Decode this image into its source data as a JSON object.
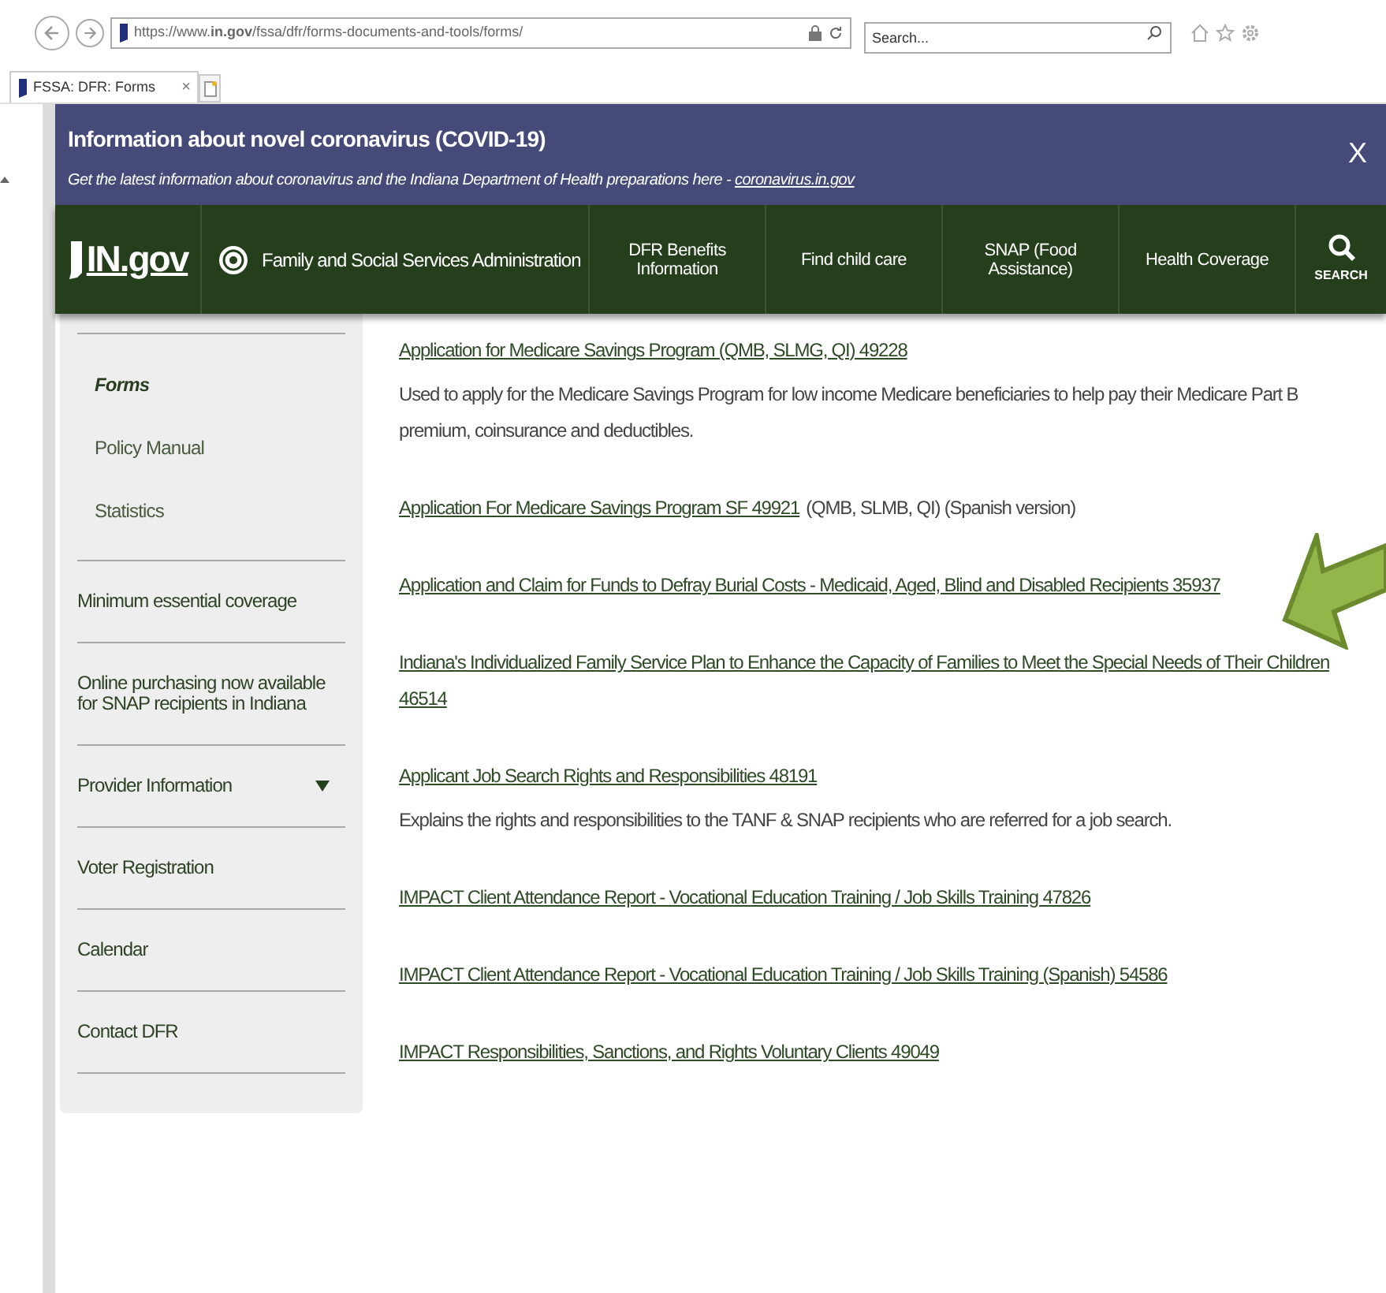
{
  "browser": {
    "url": "https://www.**in.gov**/fssa/dfr/forms-documents-and-tools/forms/",
    "search": {
      "placeholder": "Search..."
    },
    "tabs": [
      {
        "title": "FSSA: DFR: Forms",
        "close": "×",
        "selected": true
      }
    ]
  },
  "alert": {
    "title": "Information about novel coronavirus (COVID-19)",
    "text": "Get the latest information about coronavirus and the Indiana Department of Health preparations here - ",
    "link": "coronavirus.in.gov",
    "close": "X"
  },
  "header": {
    "logo": "IN.gov",
    "agency": "Family and Social Services Administration",
    "nav": [
      {
        "label": "DFR Benefits Information"
      },
      {
        "label": "Find child care"
      },
      {
        "label": "SNAP (Food Assistance)"
      },
      {
        "label": "Health Coverage"
      }
    ],
    "search_label": "SEARCH"
  },
  "sidebar": {
    "sub_items": [
      {
        "label": "Forms",
        "selected": true
      },
      {
        "label": "Policy Manual",
        "selected": false
      },
      {
        "label": "Statistics",
        "selected": false
      }
    ],
    "items": [
      {
        "label": "Minimum essential coverage",
        "kind": "link"
      },
      {
        "label": "Online purchasing now available for SNAP recipients in Indiana",
        "kind": "link"
      },
      {
        "label": "Provider Information",
        "kind": "dropdown"
      },
      {
        "label": "Voter Registration",
        "kind": "link"
      },
      {
        "label": "Calendar",
        "kind": "link"
      },
      {
        "label": "Contact DFR",
        "kind": "link"
      }
    ]
  },
  "forms": [
    {
      "link": "Application for Medicare Savings Program (QMB, SLMG, QI) 49228",
      "description": "Used to apply for the Medicare Savings Program for low income Medicare beneficiaries to help pay their Medicare Part B premium, coinsurance and deductibles."
    },
    {
      "link": "Application For Medicare Savings Program SF 49921",
      "suffix": "(QMB, SLMB, QI) (Spanish version)"
    },
    {
      "link": "Application and Claim for Funds to Defray Burial Costs - Medicaid, Aged, Blind and Disabled Recipients 35937"
    },
    {
      "link": "Indiana's Individualized Family Service Plan to Enhance the Capacity of Families to Meet the Special Needs of Their Children 46514"
    },
    {
      "link": "Applicant Job Search Rights and Responsibilities 48191",
      "description": "Explains the rights and responsibilities to the TANF & SNAP recipients who are referred for a job search."
    },
    {
      "link": "IMPACT Client Attendance Report - Vocational Education Training / Job Skills Training 47826"
    },
    {
      "link": "IMPACT Client Attendance Report - Vocational Education Training / Job Skills Training (Spanish) 54586"
    },
    {
      "link": "IMPACT Responsibilities, Sanctions, and Rights Voluntary Clients 49049"
    }
  ]
}
